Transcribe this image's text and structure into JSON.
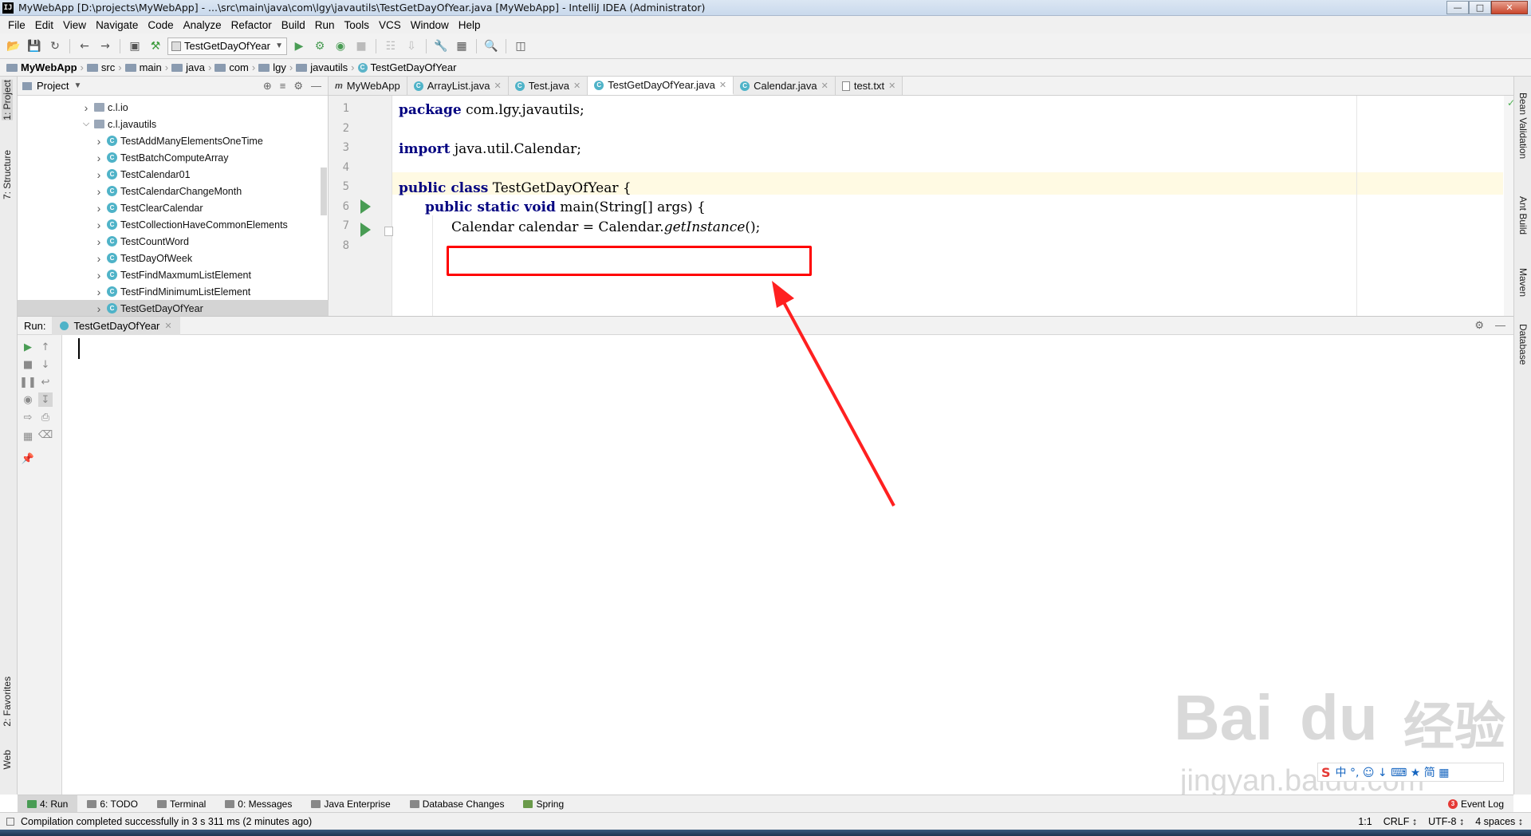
{
  "window": {
    "title": "MyWebApp [D:\\projects\\MyWebApp] - ...\\src\\main\\java\\com\\lgy\\javautils\\TestGetDayOfYear.java [MyWebApp] - IntelliJ IDEA (Administrator)",
    "app_icon": "IJ",
    "buttons": {
      "minimize": "—",
      "maximize": "□",
      "close": "✕"
    }
  },
  "menu": [
    "File",
    "Edit",
    "View",
    "Navigate",
    "Code",
    "Analyze",
    "Refactor",
    "Build",
    "Run",
    "Tools",
    "VCS",
    "Window",
    "Help"
  ],
  "toolbar": {
    "run_config": "TestGetDayOfYear"
  },
  "breadcrumb": [
    "MyWebApp",
    "src",
    "main",
    "java",
    "com",
    "lgy",
    "javautils",
    "TestGetDayOfYear"
  ],
  "left_strip": {
    "project": "1: Project",
    "structure": "7: Structure",
    "favorites": "2: Favorites",
    "web": "Web"
  },
  "right_strip": {
    "bean": "Bean Validation",
    "ant": "Ant Build",
    "maven": "Maven",
    "database": "Database"
  },
  "project_panel": {
    "header": "Project",
    "tree": [
      {
        "label": "c.l.io",
        "type": "package",
        "expanded": false,
        "indent": 0
      },
      {
        "label": "c.l.javautils",
        "type": "package",
        "expanded": true,
        "indent": 0
      },
      {
        "label": "TestAddManyElementsOneTime",
        "type": "class",
        "indent": 1
      },
      {
        "label": "TestBatchComputeArray",
        "type": "class",
        "indent": 1
      },
      {
        "label": "TestCalendar01",
        "type": "class",
        "indent": 1
      },
      {
        "label": "TestCalendarChangeMonth",
        "type": "class",
        "indent": 1
      },
      {
        "label": "TestClearCalendar",
        "type": "class",
        "indent": 1
      },
      {
        "label": "TestCollectionHaveCommonElements",
        "type": "class",
        "indent": 1
      },
      {
        "label": "TestCountWord",
        "type": "class",
        "indent": 1
      },
      {
        "label": "TestDayOfWeek",
        "type": "class",
        "indent": 1
      },
      {
        "label": "TestFindMaxmumListElement",
        "type": "class",
        "indent": 1
      },
      {
        "label": "TestFindMinimumListElement",
        "type": "class",
        "indent": 1
      },
      {
        "label": "TestGetDayOfYear",
        "type": "class",
        "indent": 1,
        "selected": true
      }
    ]
  },
  "editor_tabs": [
    {
      "label": "MyWebApp",
      "kind": "module"
    },
    {
      "label": "ArrayList.java",
      "kind": "class"
    },
    {
      "label": "Test.java",
      "kind": "class"
    },
    {
      "label": "TestGetDayOfYear.java",
      "kind": "class",
      "active": true
    },
    {
      "label": "Calendar.java",
      "kind": "class"
    },
    {
      "label": "test.txt",
      "kind": "text"
    }
  ],
  "editor": {
    "line_numbers": [
      "1",
      "2",
      "3",
      "4",
      "5",
      "6",
      "7",
      "8"
    ],
    "lines": {
      "l1_kw": "package",
      "l1_rest": " com.lgy.javautils;",
      "l3_kw": "import",
      "l3_rest": " java.util.Calendar;",
      "l5_kw": "public class",
      "l5_rest": " TestGetDayOfYear {",
      "l6_kw": "public static void",
      "l6_rest": " main(String[] args) {",
      "l7_a": "Calendar calendar = Calendar.",
      "l7_b": "getInstance",
      "l7_c": "();"
    }
  },
  "run_panel": {
    "label": "Run:",
    "tab": "TestGetDayOfYear"
  },
  "bottom_tools": [
    "4: Run",
    "6: TODO",
    "Terminal",
    "0: Messages",
    "Java Enterprise",
    "Database Changes",
    "Spring"
  ],
  "event_log": "Event Log",
  "status": {
    "message": "Compilation completed successfully in 3 s 311 ms (2 minutes ago)",
    "position": "1:1",
    "line_sep": "CRLF ↕",
    "encoding": "UTF-8 ↕",
    "indent": "4 spaces ↕"
  },
  "watermark": {
    "logo": "Bai",
    "logo2": "du",
    "cn": "经验",
    "url": "jingyan.baidu.com"
  },
  "ime": {
    "logo": "S",
    "items": "中 °, ☺ ↓ ⌨ ★ 简 ▦"
  },
  "colors": {
    "highlight": "#ff0000",
    "keyword": "#000080",
    "run_green": "#499c54",
    "current_line": "#fffae3"
  }
}
